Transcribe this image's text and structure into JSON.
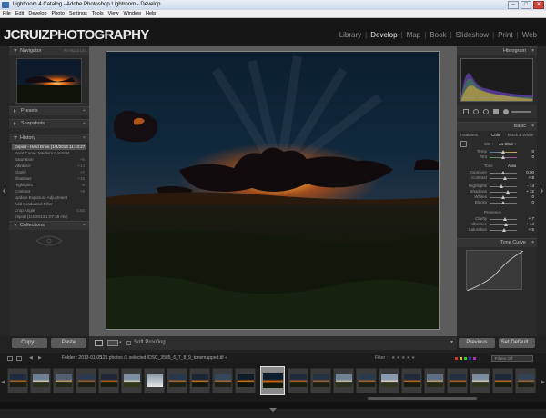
{
  "window": {
    "title": "Lightroom 4 Catalog - Adobe Photoshop Lightroom - Develop"
  },
  "menubar": [
    "File",
    "Edit",
    "Develop",
    "Photo",
    "Settings",
    "Tools",
    "View",
    "Window",
    "Help"
  ],
  "identity_plate": {
    "left": "JC",
    "mid": "RUIZ",
    "right": "PHOTOGRAPHY"
  },
  "modules": [
    "Library",
    "Develop",
    "Map",
    "Book",
    "Slideshow",
    "Print",
    "Web"
  ],
  "active_module": "Develop",
  "left_panel": {
    "navigator": {
      "title": "Navigator",
      "zoom_opts": [
        "FIT",
        "FILL",
        "1:1",
        "2:1"
      ]
    },
    "presets": "Presets",
    "snapshots": "Snapshots",
    "history": {
      "title": "History",
      "items": [
        {
          "label": "Export - Hard Drive (1/4/2013 11:10:27 ...",
          "value": ""
        },
        {
          "label": "Point Curve: Medium Contrast",
          "value": ""
        },
        {
          "label": "Saturation",
          "value": "+5"
        },
        {
          "label": "Vibrance",
          "value": "+14"
        },
        {
          "label": "Clarity",
          "value": "+7"
        },
        {
          "label": "Shadows",
          "value": "+15"
        },
        {
          "label": "Highlights",
          "value": "-6"
        },
        {
          "label": "Contrast",
          "value": "+8"
        },
        {
          "label": "Update Exposure Adjustment",
          "value": ""
        },
        {
          "label": "Add Graduated Filter",
          "value": ""
        },
        {
          "label": "Crop Angle",
          "value": "0.93"
        },
        {
          "label": "Import (1/4/2013 1:07:48 AM)",
          "value": ""
        }
      ]
    },
    "collections": "Collections",
    "copy_label": "Copy...",
    "paste_label": "Paste"
  },
  "toolbar": {
    "soft_proofing": "Soft Proofing"
  },
  "right_panel": {
    "histogram_title": "Histogram",
    "histogram_info": [
      "ISO 200",
      "23mm",
      "f/11",
      "1/250 sec"
    ],
    "basic_title": "Basic",
    "treatment": {
      "label": "Treatment :",
      "color": "Color",
      "bw": "Black & White"
    },
    "wb": {
      "label": "WB :",
      "value": "As Shot ÷"
    },
    "temp": {
      "label": "Temp",
      "value": "0"
    },
    "tint": {
      "label": "Tint",
      "value": "0"
    },
    "tone": {
      "label": "Tone",
      "auto": "Auto"
    },
    "exposure": {
      "label": "Exposure",
      "value": "0.00"
    },
    "contrast": {
      "label": "Contrast",
      "value": "+ 8"
    },
    "highlights": {
      "label": "Highlights",
      "value": "- 14"
    },
    "shadows": {
      "label": "Shadows",
      "value": "+ 32"
    },
    "whites": {
      "label": "Whites",
      "value": "0"
    },
    "blacks": {
      "label": "Blacks",
      "value": "0"
    },
    "presence": "Presence",
    "clarity": {
      "label": "Clarity",
      "value": "+ 7"
    },
    "vibrance": {
      "label": "Vibrance",
      "value": "+ 14"
    },
    "saturation": {
      "label": "Saturation",
      "value": "+ 5"
    },
    "tone_curve": "Tone Curve",
    "previous_label": "Previous",
    "reset_label": "Set Default..."
  },
  "filmstrip": {
    "folder": "Folder : 2013-01-05",
    "count": "125 photos /1 selected /DSC_3585_6_7_8_9_tonemapped.tif ÷",
    "filter_label": "Filter :",
    "filter_value": "Filters Off"
  },
  "colors": {
    "accent": "#e8e8e8",
    "sun": "#ff9a1e",
    "sky": "#0e2236"
  }
}
